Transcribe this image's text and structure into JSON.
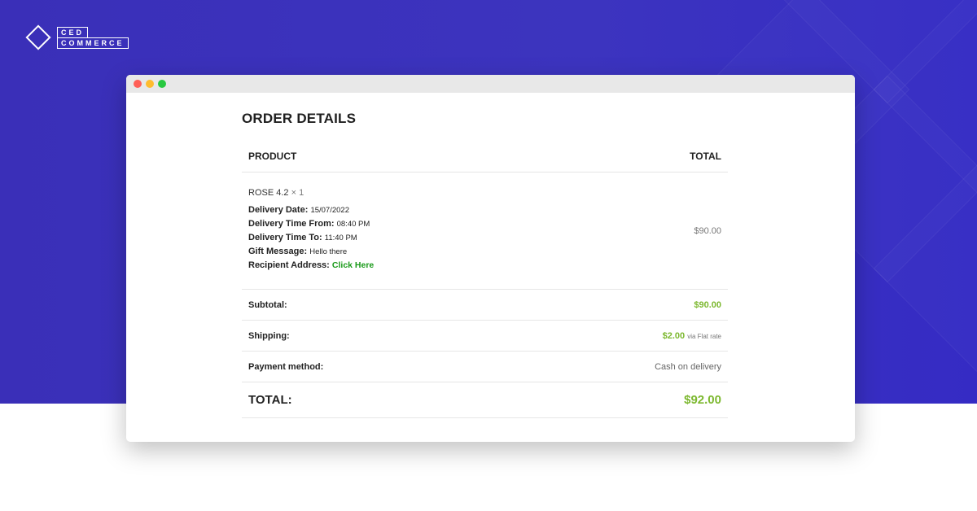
{
  "brand": {
    "logo_top": "CED",
    "logo_bottom": "COMMERCE"
  },
  "colors": {
    "background": "#3a2fb8",
    "accent_green": "#7cb82f",
    "link_green": "#1a9a1a",
    "dot_red": "#ff5f57",
    "dot_yellow": "#febc2e",
    "dot_green": "#28c840"
  },
  "order": {
    "title": "ORDER DETAILS",
    "columns": {
      "product": "PRODUCT",
      "total": "TOTAL"
    },
    "item": {
      "name": "ROSE 4.2",
      "qty": "× 1",
      "price": "$90.00",
      "meta": [
        {
          "label": "Delivery Date:",
          "value": "15/07/2022"
        },
        {
          "label": "Delivery Time From:",
          "value": "08:40 PM"
        },
        {
          "label": "Delivery Time To:",
          "value": "11:40 PM"
        },
        {
          "label": "Gift Message:",
          "value": "Hello there"
        },
        {
          "label": "Recipient Address:",
          "value": "Click Here"
        }
      ]
    },
    "subtotal": {
      "label": "Subtotal:",
      "value": "$90.00"
    },
    "shipping": {
      "label": "Shipping:",
      "value": "$2.00",
      "note": "via Flat rate"
    },
    "payment": {
      "label": "Payment method:",
      "value": "Cash on delivery"
    },
    "total": {
      "label": "TOTAL:",
      "value": "$92.00"
    }
  }
}
